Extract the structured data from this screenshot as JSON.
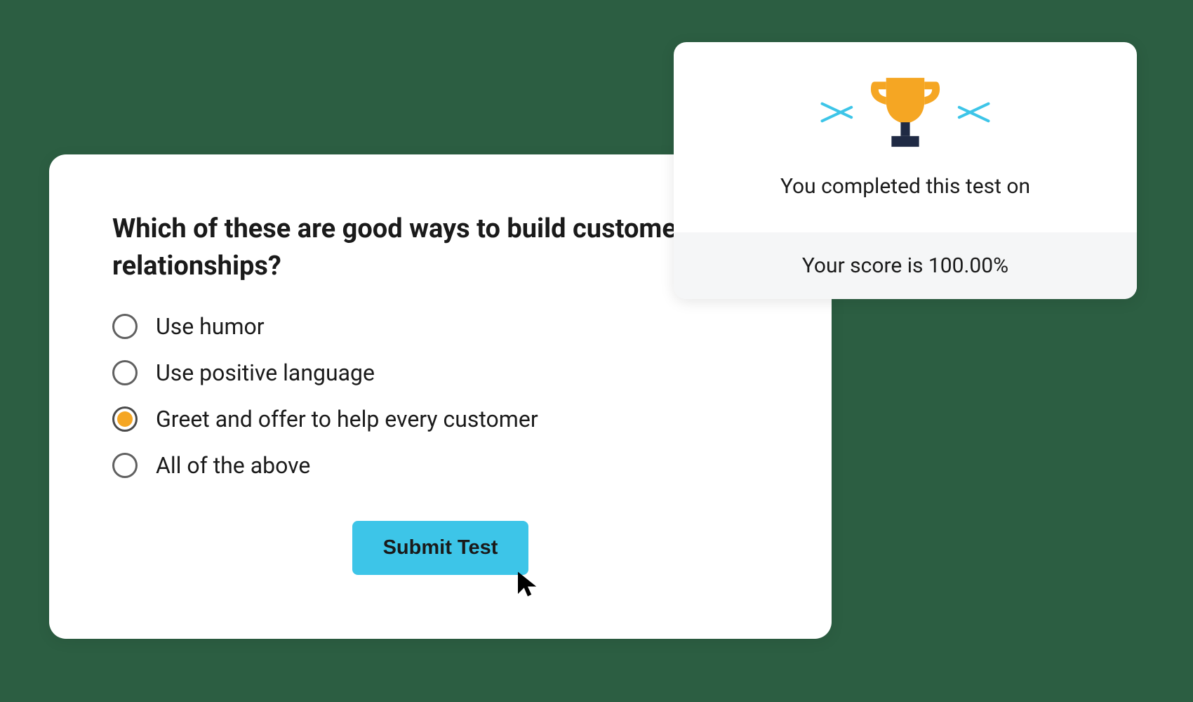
{
  "quiz": {
    "question": "Which of these are good ways to build customer relationships?",
    "options": [
      {
        "label": "Use humor",
        "selected": false
      },
      {
        "label": "Use positive language",
        "selected": false
      },
      {
        "label": "Greet and offer to help every customer",
        "selected": true
      },
      {
        "label": "All of the above",
        "selected": false
      }
    ],
    "submit_label": "Submit Test"
  },
  "result": {
    "completion_text": "You completed this test on",
    "score_text": "Your score is 100.00%"
  }
}
